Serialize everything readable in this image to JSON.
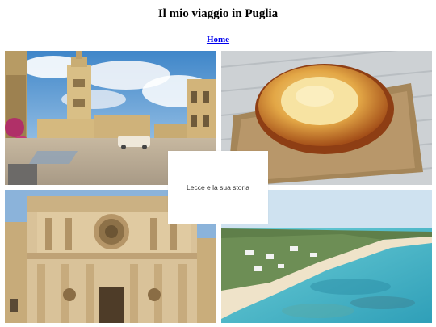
{
  "header": {
    "title": "Il mio viaggio in Puglia"
  },
  "nav": {
    "home_label": "Home"
  },
  "gallery": {
    "caption": "Lecce e la sua storia",
    "tiles": [
      {
        "name": "piazza-duomo-lecce-photo"
      },
      {
        "name": "pasticciotto-pastry-photo"
      },
      {
        "name": "basilica-santa-croce-photo"
      },
      {
        "name": "salento-beach-photo"
      }
    ]
  }
}
